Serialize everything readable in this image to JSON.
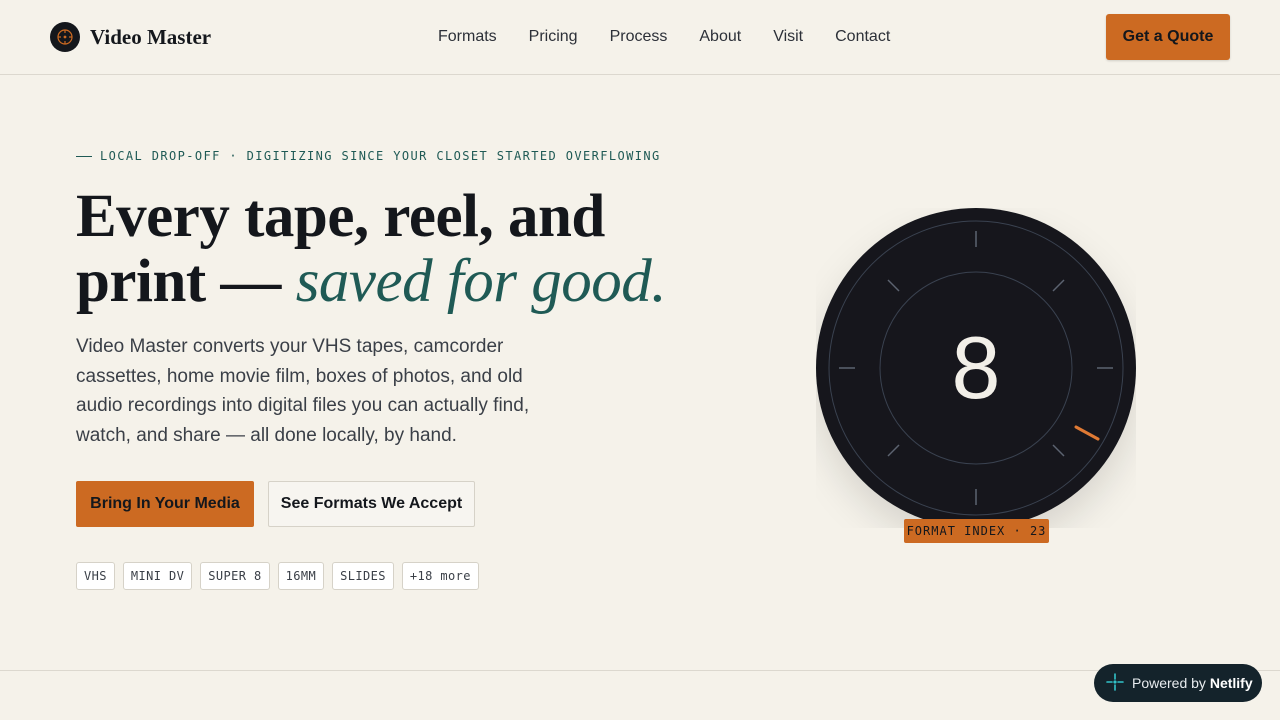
{
  "brand": {
    "name": "Video Master",
    "logo_icon": "crosshair-dial-icon"
  },
  "nav": {
    "links": [
      "Formats",
      "Pricing",
      "Process",
      "About",
      "Visit",
      "Contact"
    ],
    "cta_label": "Get a Quote"
  },
  "hero": {
    "eyebrow": "LOCAL DROP-OFF · DIGITIZING SINCE YOUR CLOSET STARTED OVERFLOWING",
    "headline_line1": "Every tape, reel, and",
    "headline_line2_plain": "print —",
    "headline_line2_accent": "saved for good.",
    "lead": "Video Master converts your VHS tapes, camcorder cassettes, home movie film, boxes of photos, and old audio recordings into digital files you can actually find, watch, and share — all done locally, by hand.",
    "primary_button": "Bring In Your Media",
    "secondary_button": "See Formats We Accept",
    "tags": [
      "VHS",
      "MINI DV",
      "SUPER 8",
      "16MM",
      "SLIDES",
      "+18 more"
    ]
  },
  "dial": {
    "number": "8",
    "label": "FORMAT INDEX · 23"
  },
  "badge": {
    "prefix": "Powered by",
    "brand": "Netlify",
    "icon": "netlify-icon"
  },
  "colors": {
    "background": "#f5f2ea",
    "accent": "#cc6a22",
    "teal": "#1f5a55",
    "ink": "#14171c"
  }
}
